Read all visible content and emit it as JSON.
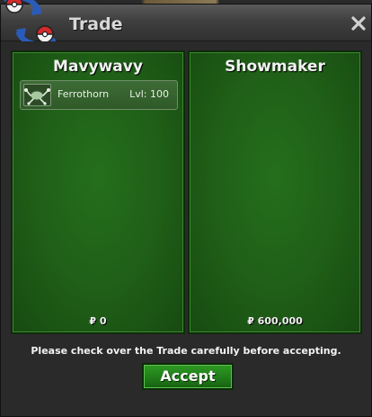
{
  "window": {
    "title": "Trade",
    "close_icon": "close-icon",
    "logo_icon": "trade-exchange-icon"
  },
  "left_panel": {
    "player_name": "Mavywavy",
    "items": [
      {
        "name": "Ferrothorn",
        "level": "Lvl: 100",
        "icon": "ferrothorn-icon"
      }
    ],
    "money": "₽ 0"
  },
  "right_panel": {
    "player_name": "Showmaker",
    "items": [],
    "money": "₽ 600,000"
  },
  "notice": "Please check over the Trade carefully before accepting.",
  "accept_label": "Accept",
  "colors": {
    "panel_green": "#1f5e17",
    "button_green": "#1f7a18",
    "window_bg": "#2b2b2b",
    "title_text": "#d8d8d8"
  }
}
